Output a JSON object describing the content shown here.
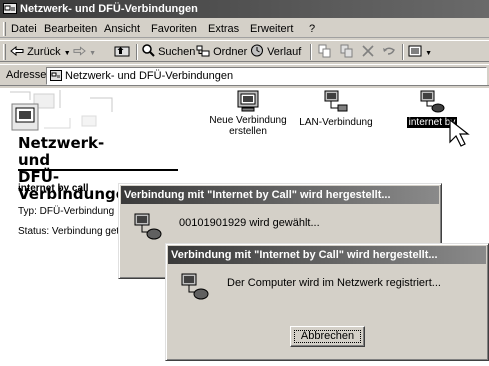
{
  "window": {
    "title": "Netzwerk- und DFÜ-Verbindungen"
  },
  "menu": {
    "items": [
      "Datei",
      "Bearbeiten",
      "Ansicht",
      "Favoriten",
      "Extras",
      "Erweitert",
      "?"
    ]
  },
  "toolbar": {
    "back_label": "Zurück",
    "search_label": "Suchen",
    "folders_label": "Ordner",
    "history_label": "Verlauf"
  },
  "addressbar": {
    "label": "Adresse",
    "value": "Netzwerk- und DFÜ-Verbindungen"
  },
  "leftpanel": {
    "folder_title_line1": "Netzwerk- und",
    "folder_title_line2": "DFÜ-Verbindungen",
    "selected_name": "internet by call",
    "selected_type": "Typ: DFÜ-Verbindung",
    "selected_status": "Status: Verbindung getr"
  },
  "items": [
    {
      "line1": "Neue Verbindung",
      "line2": "erstellen"
    },
    {
      "line1": "LAN-Verbindung",
      "line2": ""
    },
    {
      "line1": "internet by",
      "line2": ""
    }
  ],
  "dialog1": {
    "title": "Verbindung mit \"Internet by Call\" wird hergestellt...",
    "message": "00101901929 wird gewählt..."
  },
  "dialog2": {
    "title": "Verbindung mit \"Internet by Call\" wird hergestellt...",
    "message": "Der Computer wird im Netzwerk registriert...",
    "cancel_label": "Abbrechen"
  }
}
